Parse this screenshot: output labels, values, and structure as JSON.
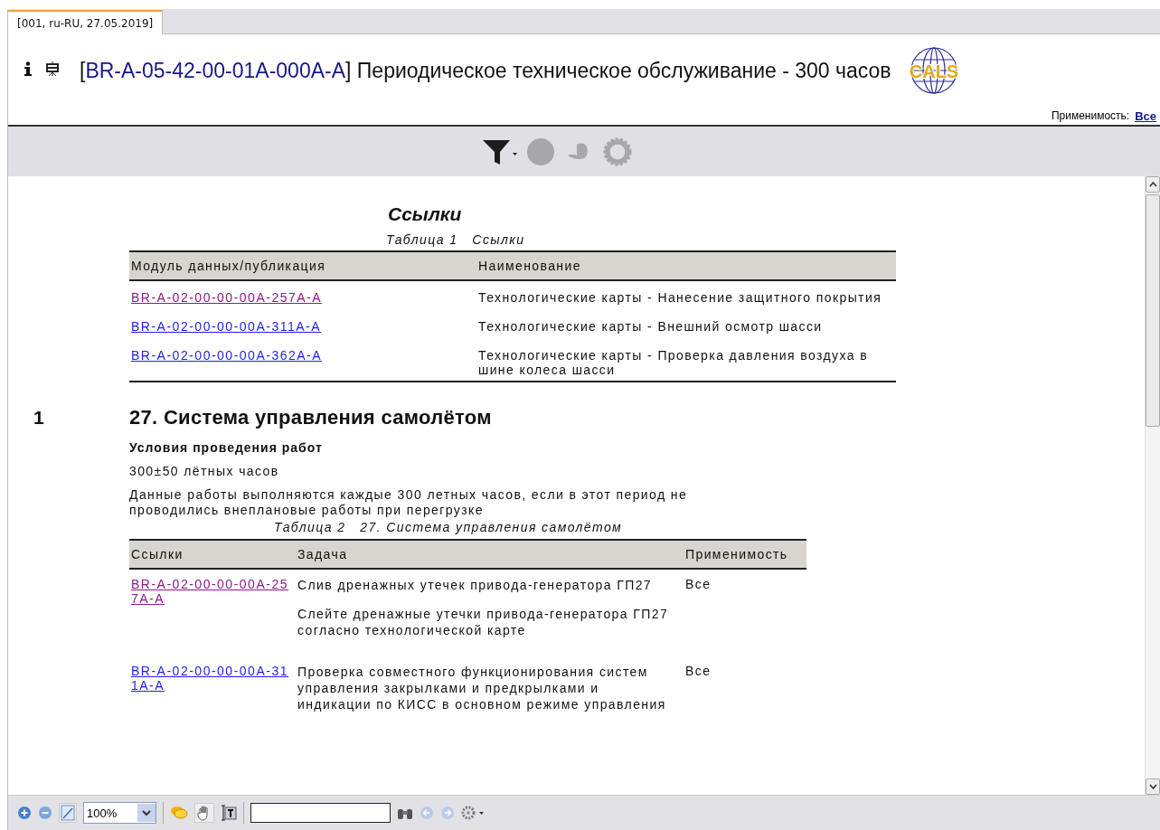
{
  "tab": {
    "label": "[001, ru-RU, 27.05.2019]",
    "selected": true
  },
  "header": {
    "code_open": "[",
    "code_close": "]",
    "code": "BR-A-05-42-00-01A-000A-A",
    "title": "Периодическое техническое обслуживание - 300 часов",
    "logo_text": "CALS",
    "applicability_label": "Применимость:",
    "applicability_value": "Все"
  },
  "references": {
    "heading": "Ссылки",
    "caption": "Таблица 1   Ссылки",
    "columns": [
      "Модуль данных/публикация",
      "Наименование"
    ],
    "rows": [
      {
        "link": "BR-A-02-00-00-00A-257A-A",
        "visited": true,
        "name": "Технологические карты - Нанесение защитного покрытия"
      },
      {
        "link": "BR-A-02-00-00-00A-311A-A",
        "visited": false,
        "name": "Технологические карты - Внешний осмотр шасси"
      },
      {
        "link": "BR-A-02-00-00-00A-362A-A",
        "visited": false,
        "name": "Технологические карты - Проверка давления воздуха в шине колеса шасси"
      }
    ]
  },
  "section": {
    "number": "1",
    "heading": "27. Система управления самолётом",
    "conditions_title": "Условия проведения работ",
    "conditions_value": "300±50 лётных часов",
    "description": "Данные работы выполняются каждые 300 летных часов, если в этот период не проводились внеплановые работы при перегрузке",
    "caption": "Таблица 2   27. Система управления самолётом",
    "columns": [
      "Ссылки",
      "Задача",
      "Применимость"
    ],
    "rows": [
      {
        "link": "BR-A-02-00-00-00A-257A-A",
        "visited": true,
        "tasks": [
          "Слив дренажных утечек привода-генератора ГП27",
          "Слейте дренажные утечки привода-генератора ГП27 согласно технологической карте"
        ],
        "applicability": "Все"
      },
      {
        "link": "BR-A-02-00-00-00A-311A-A",
        "visited": false,
        "tasks": [
          "Проверка совместного функционирования систем управления закрылками и предкрылками и индикации по КИСС в основном режиме управления"
        ],
        "applicability": "Все"
      }
    ]
  },
  "bottom_toolbar": {
    "zoom": "100%"
  }
}
